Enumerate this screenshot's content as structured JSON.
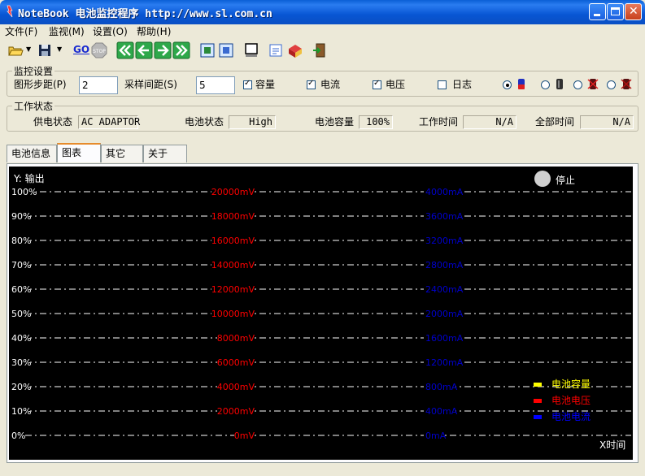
{
  "window": {
    "title": "NoteBook 电池监控程序 http://www.sl.com.cn"
  },
  "menu": [
    "文件(F)",
    "监视(M)",
    "设置(O)",
    "帮助(H)"
  ],
  "toolbar": {
    "buttons": [
      "open-icon",
      "save-icon",
      "go-icon",
      "stop-icon",
      "first-icon",
      "prev-icon",
      "next-icon",
      "last-icon",
      "fit-icon",
      "zoom-icon",
      "window-icon",
      "note-icon",
      "package-icon",
      "exit-icon"
    ],
    "go_label": "GO",
    "stop_label": "STOP"
  },
  "monitor": {
    "title": "监控设置",
    "step_label": "图形步距(P)",
    "step_value": "2",
    "interval_label": "采样间距(S)",
    "interval_value": "5",
    "checks": [
      {
        "label": "容量",
        "checked": true
      },
      {
        "label": "电流",
        "checked": true
      },
      {
        "label": "电压",
        "checked": true
      },
      {
        "label": "日志",
        "checked": false
      }
    ]
  },
  "status": {
    "title": "工作状态",
    "power_label": "供电状态",
    "power_value": "AC ADAPTOR",
    "battery_label": "电池状态",
    "battery_value": "High",
    "capacity_label": "电池容量",
    "capacity_value": "100%",
    "worktime_label": "工作时间",
    "worktime_value": "N/A",
    "totaltime_label": "全部时间",
    "totaltime_value": "N/A"
  },
  "tabs": [
    "电池信息",
    "图表",
    "其它",
    "关于"
  ],
  "active_tab": 1,
  "chart": {
    "y_label": "Y: 输出",
    "x_label": "X时间",
    "stop_label": "停止",
    "percent_ticks": [
      "100%",
      "90%",
      "80%",
      "70%",
      "60%",
      "50%",
      "40%",
      "30%",
      "20%",
      "10%",
      "0%"
    ],
    "voltage_ticks": [
      "20000mV",
      "18000mV",
      "16000mV",
      "14000mV",
      "12000mV",
      "10000mV",
      "8000mV",
      "6000mV",
      "4000mV",
      "2000mV",
      "0mV"
    ],
    "current_ticks": [
      "4000mA",
      "3600mA",
      "3200mA",
      "2800mA",
      "2400mA",
      "2000mA",
      "1600mA",
      "1200mA",
      "800mA",
      "400mA",
      "0mA"
    ],
    "legend": [
      {
        "label": "电池容量",
        "color": "#ffff00"
      },
      {
        "label": "电池电压",
        "color": "#ff0000"
      },
      {
        "label": "电池电流",
        "color": "#0000ff"
      }
    ]
  },
  "colors": {
    "voltage": "#ff0000",
    "current": "#0000cc",
    "percent": "#ffffff",
    "legend_capacity": "#ffff00"
  }
}
